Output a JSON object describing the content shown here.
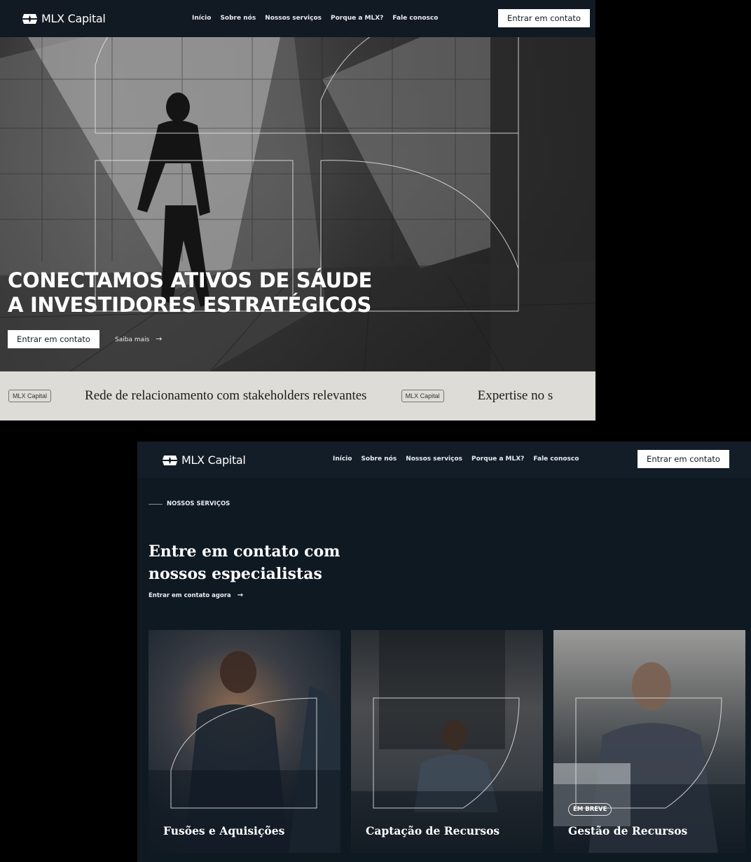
{
  "brand": {
    "name": "MLX Capital"
  },
  "nav": {
    "links": [
      "Início",
      "Sobre nós",
      "Nossos serviços",
      "Porque a MLX?",
      "Fale conosco"
    ],
    "cta": "Entrar em contato"
  },
  "hero": {
    "title_line1": "CONECTAMOS ATIVOS DE SÁUDE",
    "title_line2": "A INVESTIDORES ESTRATÉGICOS",
    "primary_button": "Entrar em contato",
    "secondary_link": "Saiba mais",
    "arrow": "→"
  },
  "ticker": {
    "items": [
      {
        "tag": "MLX Capital",
        "text": "Rede de relacionamento com stakeholders relevantes"
      },
      {
        "tag": "MLX Capital",
        "text": "Expertise no s"
      }
    ]
  },
  "services": {
    "eyebrow": "NOSSOS SERVIÇOS",
    "title_line1": "Entre em contato com",
    "title_line2": "nossos especialistas",
    "link": "Entrar em contato agora",
    "arrow": "→",
    "cards": [
      {
        "title": "Fusões e Aquisições",
        "badge": ""
      },
      {
        "title": "Captação de Recursos",
        "badge": ""
      },
      {
        "title": "Gestão de Recursos",
        "badge": "EM BREVE"
      }
    ]
  },
  "colors": {
    "navy": "#111923",
    "white": "#ffffff",
    "ticker_bg": "#dedcd6"
  }
}
